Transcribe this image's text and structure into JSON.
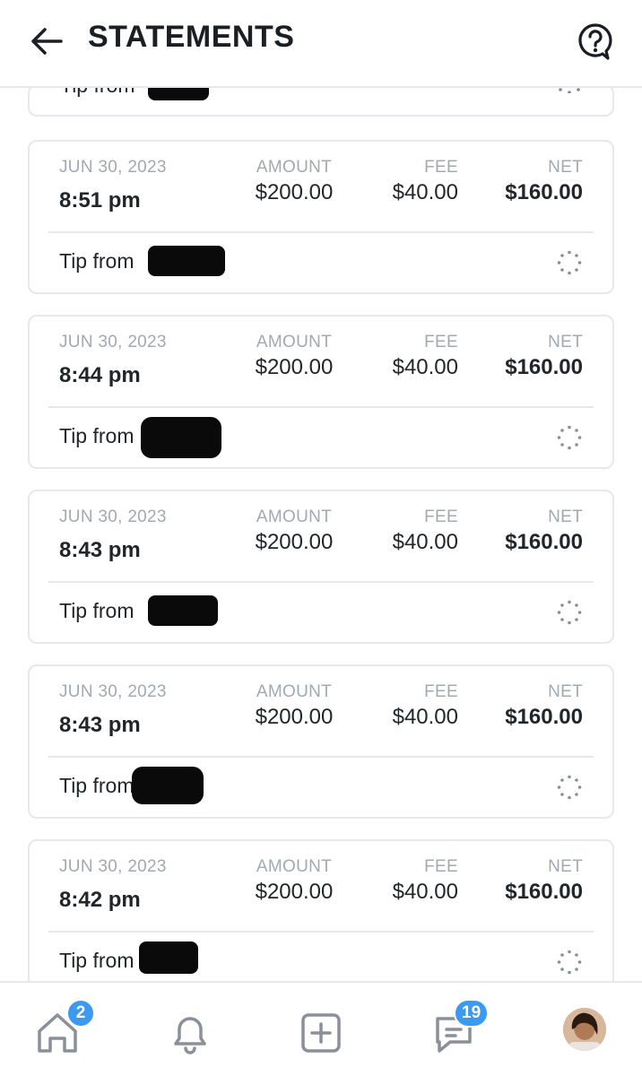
{
  "header": {
    "title": "STATEMENTS"
  },
  "labels": {
    "amount": "AMOUNT",
    "fee": "FEE",
    "net": "NET",
    "tip": "Tip from"
  },
  "partial_top": {
    "tip_label": "Tip from"
  },
  "statements": [
    {
      "date": "JUN 30, 2023",
      "time": "8:51 pm",
      "amount": "$200.00",
      "fee": "$40.00",
      "net": "$160.00",
      "tip_label": "Tip from"
    },
    {
      "date": "JUN 30, 2023",
      "time": "8:44 pm",
      "amount": "$200.00",
      "fee": "$40.00",
      "net": "$160.00",
      "tip_label": "Tip from"
    },
    {
      "date": "JUN 30, 2023",
      "time": "8:43 pm",
      "amount": "$200.00",
      "fee": "$40.00",
      "net": "$160.00",
      "tip_label": "Tip from"
    },
    {
      "date": "JUN 30, 2023",
      "time": "8:43 pm",
      "amount": "$200.00",
      "fee": "$40.00",
      "net": "$160.00",
      "tip_label": "Tip from"
    },
    {
      "date": "JUN 30, 2023",
      "time": "8:42 pm",
      "amount": "$200.00",
      "fee": "$40.00",
      "net": "$160.00",
      "tip_label": "Tip from"
    }
  ],
  "nav": {
    "home_badge": "2",
    "messages_badge": "19",
    "icons": [
      "home-icon",
      "bell-icon",
      "plus-square-icon",
      "chat-icon",
      "avatar"
    ]
  },
  "colors": {
    "accent": "#3b9af0",
    "muted": "#a3a9b1",
    "text": "#22262a",
    "border": "#e6e8eb"
  }
}
